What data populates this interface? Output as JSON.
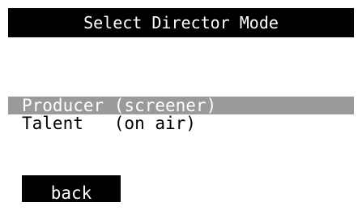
{
  "title": "Select Director Mode",
  "menu": {
    "items": [
      {
        "label": "Producer (screener)",
        "selected": true
      },
      {
        "label": "Talent   (on air)",
        "selected": false
      }
    ]
  },
  "actions": {
    "back_label": "back"
  },
  "colors": {
    "background": "#ffffff",
    "title_bar": "#000000",
    "selection_highlight": "#9a9a9a",
    "button": "#000000",
    "text_dark": "#000000",
    "text_light": "#ffffff"
  }
}
